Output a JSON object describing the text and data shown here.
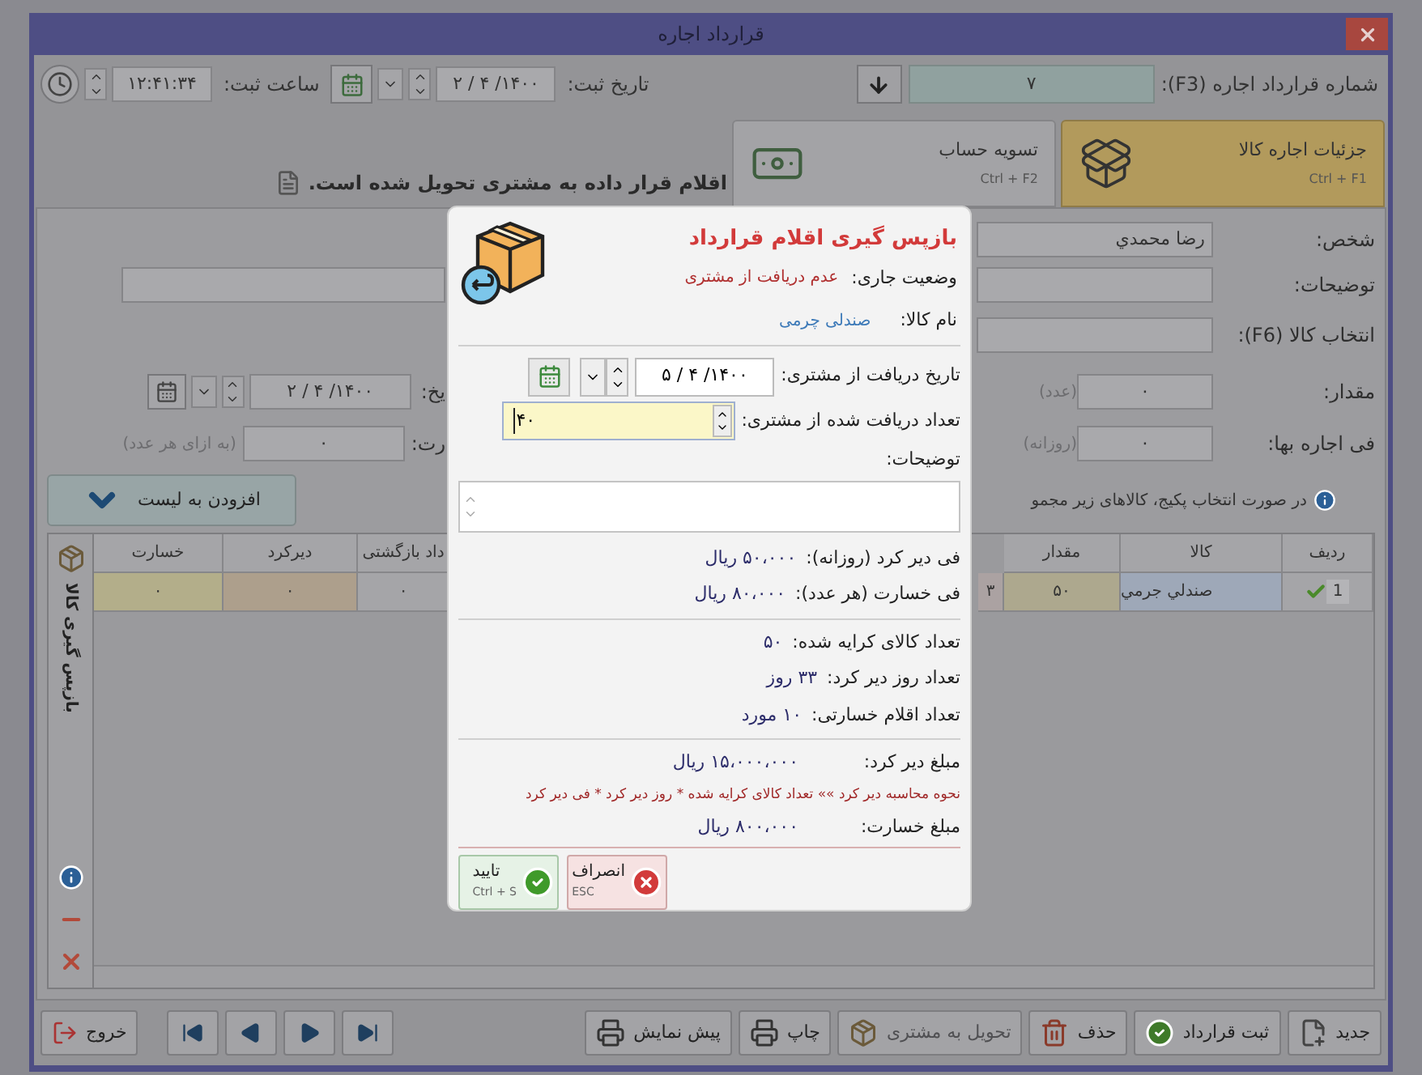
{
  "window": {
    "title": "قرارداد اجاره"
  },
  "header": {
    "contract_label": "شماره قرارداد اجاره (F3):",
    "contract_number": "۷",
    "date_label": "تاریخ ثبت:",
    "date": "۱۴۰۰/ ۴ / ۲",
    "time_label": "ساعت ثبت:",
    "time": "۱۲:۴۱:۳۴"
  },
  "tabs": [
    {
      "label": "جزئیات اجاره کالا",
      "shortcut": "Ctrl + F1",
      "selected": true
    },
    {
      "label": "تسویه حساب",
      "shortcut": "Ctrl + F2",
      "selected": false
    }
  ],
  "notice": "اقلام قرار داده به مشتری تحویل شده است.",
  "form": {
    "person_label": "شخص:",
    "person": "رضا محمدي",
    "description_label": "توضیحات:",
    "item_label": "انتخاب کالا (F6):",
    "quantity_label": "مقدار:",
    "quantity": "۰",
    "quantity_unit": "(عدد)",
    "rate_label": "فی اجاره بها:",
    "rate": "۰",
    "rate_unit": "(روزانه)",
    "date_label": "یخ:",
    "date": "۱۴۰۰/ ۴ / ۲",
    "fee_label": "رت:",
    "fee": "۰",
    "fee_unit": "(به ازای هر عدد)",
    "add_button": "افزودن به لیست",
    "info": "در صورت انتخاب پکیج، کالاهای زیر مجمو"
  },
  "side_panel": {
    "title": "بازپس گیری کالا"
  },
  "table": {
    "left_columns": [
      "داد بازگشتی",
      "دیرکرد",
      "خسارت"
    ],
    "right_columns": [
      "ردیف",
      "کالا",
      "مقدار"
    ],
    "rows": [
      {
        "checked": true,
        "row_number": "1",
        "item": "صندلي جرمي",
        "quantity": "۵۰",
        "column_4": "۳",
        "returned": "۰",
        "late": "۰",
        "damage": "۰"
      }
    ]
  },
  "toolbar": [
    {
      "label": "جدید",
      "disabled": false
    },
    {
      "label": "ثبت قرارداد",
      "disabled": false
    },
    {
      "label": "حذف",
      "disabled": false
    },
    {
      "label": "تحویل به مشتری",
      "disabled": true
    },
    {
      "label": "چاپ",
      "disabled": false
    },
    {
      "label": "پیش نمایش",
      "disabled": false
    }
  ],
  "exit_button": "خروج",
  "dialog": {
    "title": "بازپس گیری اقلام قرارداد",
    "status_label": "وضعیت جاری:",
    "status": "عدم دریافت از مشتری",
    "item_label": "نام کالا:",
    "item": "صندلی چرمی",
    "date_label": "تاریخ دریافت از مشتری:",
    "date": "۱۴۰۰/ ۴ / ۵",
    "qty_label": "تعداد دریافت شده از مشتری:",
    "qty": "۴۰",
    "notes_label": "توضیحات:",
    "rates": [
      {
        "label": "فی دیر کرد (روزانه):",
        "value": "۵۰،۰۰۰ ریال"
      },
      {
        "label": "فی خسارت (هر عدد):",
        "value": "۸۰،۰۰۰ ریال"
      }
    ],
    "counts": [
      {
        "label": "تعداد کالای کرایه شده:",
        "value": "۵۰"
      },
      {
        "label": "تعداد روز دیر کرد:",
        "value": "۳۳ روز"
      },
      {
        "label": "تعداد اقلام خسارتی:",
        "value": "۱۰ مورد"
      }
    ],
    "late_fee": {
      "label": "مبلغ دیر کرد:",
      "value": "۱۵،۰۰۰،۰۰۰ ریال"
    },
    "formula": "نحوه محاسبه دیر کرد »» تعداد کالای کرایه شده * روز دیر کرد * فی دیر کرد",
    "damage_fee": {
      "label": "مبلغ خسارت:",
      "value": "۸۰۰،۰۰۰ ریال"
    },
    "buttons": [
      {
        "kind": "cancel",
        "label": "انصراف",
        "shortcut": "ESC"
      },
      {
        "kind": "ok",
        "label": "تایید",
        "shortcut": "Ctrl + S"
      }
    ]
  }
}
